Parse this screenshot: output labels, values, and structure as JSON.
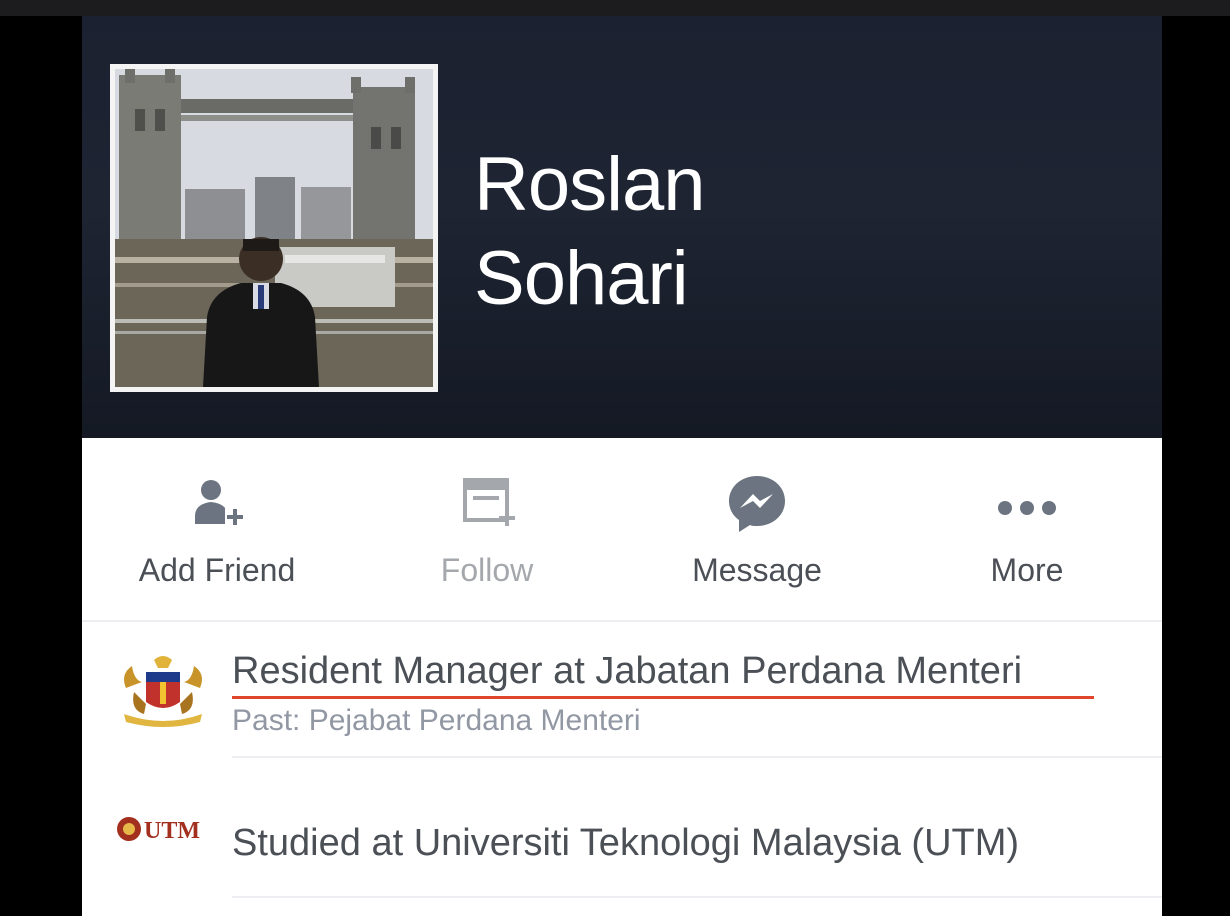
{
  "profile": {
    "first_name": "Roslan",
    "last_name": "Sohari"
  },
  "actions": [
    {
      "label": "Add Friend",
      "icon": "add-friend-icon",
      "enabled": true
    },
    {
      "label": "Follow",
      "icon": "follow-icon",
      "enabled": false
    },
    {
      "label": "Message",
      "icon": "messenger-icon",
      "enabled": true
    },
    {
      "label": "More",
      "icon": "more-dots-icon",
      "enabled": true
    }
  ],
  "info": [
    {
      "icon": "government-crest-icon",
      "title": "Resident Manager at Jabatan Perdana Menteri",
      "subtitle": "Past: Pejabat Perdana Menteri"
    },
    {
      "icon": "utm-logo-icon",
      "logo_text": "UTM",
      "title": "Studied at Universiti Teknologi Malaysia (UTM)"
    }
  ],
  "colors": {
    "header_bg": "#1b2130",
    "text": "#4b4f56",
    "muted": "#9197a3",
    "icon": "#6b7480",
    "highlight": "#e0462c"
  }
}
